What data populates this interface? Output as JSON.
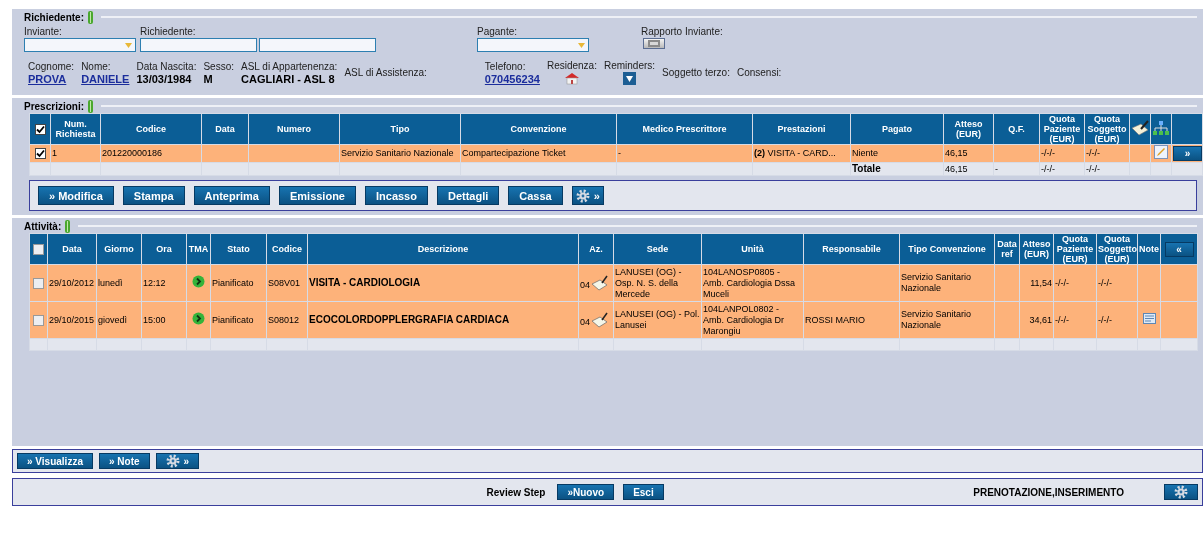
{
  "richiedente": {
    "legend": "Richiedente:",
    "fields": [
      {
        "kind": "select",
        "label": "Inviante:"
      },
      {
        "kind": "text_pair",
        "label": "Richiedente:"
      },
      {
        "kind": "select",
        "label": "Pagante:"
      },
      {
        "kind": "button",
        "label": "Rapporto Inviante:"
      }
    ],
    "patient": [
      {
        "label": "Cognome:",
        "value": "PROVA",
        "kind": "link"
      },
      {
        "label": "Nome:",
        "value": "DANIELE",
        "kind": "link"
      },
      {
        "label": "Data Nascita:",
        "value": "13/03/1984",
        "kind": "bold"
      },
      {
        "label": "Sesso:",
        "value": "M",
        "kind": "bold"
      },
      {
        "label": "ASL di Appartenenza:",
        "value": "CAGLIARI - ASL 8",
        "kind": "bold"
      },
      {
        "label": "ASL di Assistenza:",
        "kind": "none"
      }
    ],
    "contacts": [
      {
        "label": "Telefono:",
        "value": "070456234",
        "kind": "link"
      },
      {
        "label": "Residenza:",
        "kind": "icon"
      },
      {
        "label": "Reminders:",
        "kind": "icon"
      },
      {
        "label": "Soggetto terzo:",
        "kind": "none"
      },
      {
        "label": "Consensi:",
        "kind": "none"
      }
    ]
  },
  "prescrizioni": {
    "legend": "Prescrizioni:",
    "columns": [
      {
        "kind": "check",
        "checked": true
      },
      {
        "label": "Num. Richiesta"
      },
      {
        "label": "Codice"
      },
      {
        "label": "Data"
      },
      {
        "label": "Numero"
      },
      {
        "label": "Tipo"
      },
      {
        "label": "Convenzione"
      },
      {
        "label": "Medico Prescrittore"
      },
      {
        "label": "Prestazioni"
      },
      {
        "label": "Pagato"
      },
      {
        "label": "Atteso (EUR)"
      },
      {
        "label": "Q.F."
      },
      {
        "label": "Quota Paziente (EUR)"
      },
      {
        "label": "Quota Soggetto (EUR)"
      },
      {
        "kind": "icon"
      },
      {
        "kind": "icon"
      },
      {
        "kind": "blank"
      }
    ],
    "rows": [
      [
        {
          "kind": "check",
          "checked": true
        },
        "1",
        "201220000186",
        "",
        "",
        "Servizio Sanitario Nazionale",
        "Compartecipazione Ticket",
        "-",
        "**(2)** VISITA - CARD...",
        "Niente",
        "46,15",
        "",
        "-/-/-",
        "-/-/-",
        "",
        {
          "kind": "icon"
        },
        {
          "kind": "button",
          "label": "»"
        }
      ]
    ],
    "total": {
      "label": "Totale",
      "atteso": "46,15",
      "qf": "-",
      "quota_paziente": "-/-/-",
      "quota_soggetto": "-/-/-"
    },
    "buttons": [
      {
        "kind": "text",
        "label": "» Modifica"
      },
      {
        "kind": "text",
        "label": "Stampa"
      },
      {
        "kind": "text",
        "label": "Anteprima"
      },
      {
        "kind": "text",
        "label": "Emissione"
      },
      {
        "kind": "text",
        "label": "Incasso"
      },
      {
        "kind": "text",
        "label": "Dettagli"
      },
      {
        "kind": "text",
        "label": "Cassa"
      },
      {
        "kind": "gear",
        "label": "»"
      }
    ]
  },
  "attivita": {
    "legend": "Attività:",
    "columns": [
      {
        "kind": "check",
        "checked": false
      },
      {
        "label": "Data"
      },
      {
        "label": "Giorno"
      },
      {
        "label": "Ora"
      },
      {
        "label": "TMA"
      },
      {
        "label": "Stato"
      },
      {
        "label": "Codice"
      },
      {
        "label": "Descrizione"
      },
      {
        "label": "Az."
      },
      {
        "label": "Sede"
      },
      {
        "label": "Unità"
      },
      {
        "label": "Responsabile"
      },
      {
        "label": "Tipo Convenzione"
      },
      {
        "label": "Data ref"
      },
      {
        "label": "Atteso (EUR)"
      },
      {
        "label": "Quota Paziente (EUR)"
      },
      {
        "label": "Quota Soggetto (EUR)"
      },
      {
        "label": "Note"
      },
      {
        "kind": "button",
        "label": "«"
      }
    ],
    "rows": [
      [
        {
          "kind": "check",
          "checked": false
        },
        "29/10/2012",
        "lunedì",
        "12:12",
        {
          "kind": "icon"
        },
        "Pianificato",
        "S08V01",
        {
          "kind": "bold",
          "text": "VISITA - CARDIOLOGIA"
        },
        {
          "kind": "az",
          "text": "04"
        },
        "LANUSEI (OG) - Osp. N. S. della Mercede",
        "104LANOSP0805 - Amb. Cardiologia Dssa Muceli",
        "",
        "Servizio Sanitario Nazionale",
        "",
        {
          "kind": "num",
          "text": "11,54"
        },
        "-/-/-",
        "-/-/-",
        "",
        ""
      ],
      [
        {
          "kind": "check",
          "checked": false
        },
        "29/10/2015",
        "giovedì",
        "15:00",
        {
          "kind": "icon"
        },
        "Pianificato",
        "S08012",
        {
          "kind": "bold",
          "text": "ECOCOLORDOPPLERGRAFIA CARDIACA"
        },
        {
          "kind": "az",
          "text": "04"
        },
        "LANUSEI (OG) - Pol. Lanusei",
        "104LANPOL0802 - Amb. Cardiologia Dr Marongiu",
        "ROSSI MARIO",
        "Servizio Sanitario Nazionale",
        "",
        {
          "kind": "num",
          "text": "34,61"
        },
        "-/-/-",
        "-/-/-",
        {
          "kind": "icon"
        },
        ""
      ]
    ],
    "buttons": [
      {
        "kind": "text",
        "label": "» Visualizza"
      },
      {
        "kind": "text",
        "label": "» Note"
      },
      {
        "kind": "gear",
        "label": "»"
      }
    ]
  },
  "footer": {
    "label": "Review Step",
    "buttons": [
      {
        "kind": "text",
        "label": "»Nuovo"
      },
      {
        "kind": "text",
        "label": "Esci"
      }
    ],
    "mode": "PRENOTAZIONE,INSERIMENTO",
    "end_buttons": [
      {
        "kind": "gear"
      }
    ]
  }
}
